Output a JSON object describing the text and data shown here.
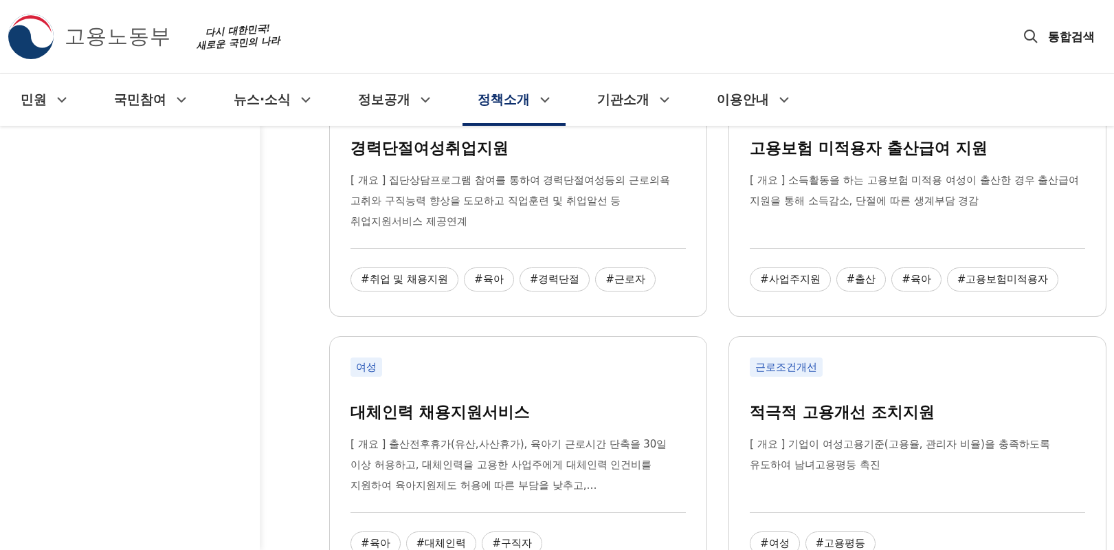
{
  "header": {
    "ministry": "고용노동부",
    "slogan_lines": [
      "다시 대한민국!",
      "새로운 국민의 나라"
    ],
    "search": "통합검색"
  },
  "nav": [
    {
      "label": "민원",
      "selected": false
    },
    {
      "label": "국민참여",
      "selected": false
    },
    {
      "label": "뉴스·소식",
      "selected": false
    },
    {
      "label": "정보공개",
      "selected": false
    },
    {
      "label": "정책소개",
      "selected": true
    },
    {
      "label": "기관소개",
      "selected": false
    },
    {
      "label": "이용안내",
      "selected": false
    }
  ],
  "cards": [
    {
      "title": "경력단절여성취업지원",
      "summary": "[ 개요 ] 집단상담프로그램 참여를 통하여 경력단절여성등의 근로의욕 고취와 구직능력 향상을 도모하고 직업훈련 및 취업알선 등 취업지원서비스 제공연계",
      "tags": [
        "#취업 및 채용지원",
        "#육아",
        "#경력단절",
        "#근로자"
      ]
    },
    {
      "title": "고용보험 미적용자 출산급여 지원",
      "summary": "[ 개요 ] 소득활동을 하는 고용보험 미적용 여성이 출산한 경우 출산급여 지원을 통해 소득감소, 단절에 따른 생계부담 경감",
      "tags": [
        "#사업주지원",
        "#출산",
        "#육아",
        "#고용보험미적용자"
      ]
    },
    {
      "category": "여성",
      "title": "대체인력 채용지원서비스",
      "summary": "[ 개요 ] 출산전후휴가(유산,사산휴가), 육아기 근로시간 단축을 30일 이상 허용하고, 대체인력을 고용한 사업주에게 대체인력 인건비를 지원하여 육아지원제도 허용에 따른 부담을 낮추고,…",
      "tags": [
        "#육아",
        "#대체인력",
        "#구직자"
      ]
    },
    {
      "category": "근로조건개선",
      "title": "적극적 고용개선 조치지원",
      "summary": "[ 개요 ] 기업이 여성고용기준(고용율, 관리자 비율)을 충족하도록 유도하여 남녀고용평등 촉진",
      "tags": [
        "#여성",
        "#고용평등"
      ]
    }
  ]
}
